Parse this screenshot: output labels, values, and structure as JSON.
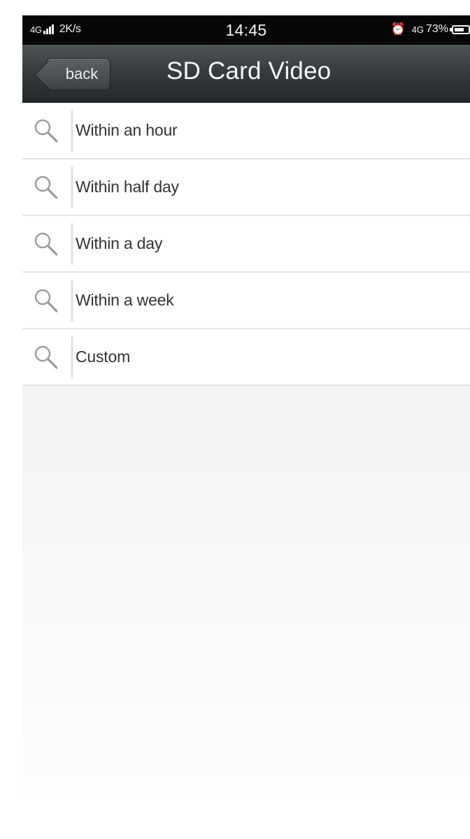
{
  "status_bar": {
    "network_left": "4G",
    "speed": "2K/s",
    "time": "14:45",
    "network_right": "4G",
    "battery": "73%",
    "battery_level": 0.73,
    "alarm_icon": "alarm-clock-icon"
  },
  "nav": {
    "back_label": "back",
    "title": "SD Card Video"
  },
  "filters": [
    {
      "label": "Within an hour",
      "icon": "search-icon"
    },
    {
      "label": "Within half day",
      "icon": "search-icon"
    },
    {
      "label": "Within a day",
      "icon": "search-icon"
    },
    {
      "label": "Within a week",
      "icon": "search-icon"
    },
    {
      "label": "Custom",
      "icon": "search-icon"
    }
  ],
  "colors": {
    "nav_bar": "#373d3f",
    "status_bar": "#070707",
    "item_text": "#333333"
  }
}
